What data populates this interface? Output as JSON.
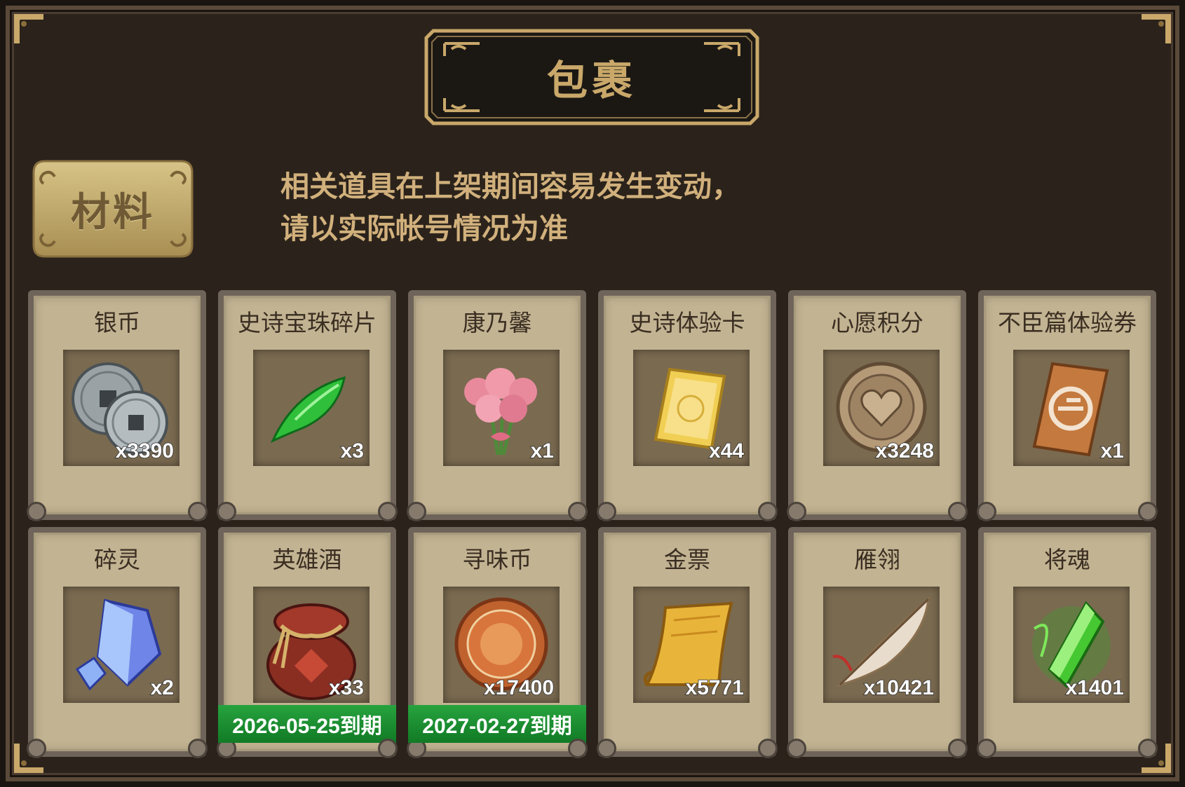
{
  "window": {
    "title": "包裹"
  },
  "tab": {
    "label": "材料"
  },
  "notice": {
    "line1": "相关道具在上架期间容易发生变动，",
    "line2": "请以实际帐号情况为准"
  },
  "items": [
    {
      "name": "银币",
      "quantity": "x3390",
      "icon": "silver-coins-icon"
    },
    {
      "name": "史诗宝珠碎片",
      "quantity": "x3",
      "icon": "green-gem-shard-icon"
    },
    {
      "name": "康乃馨",
      "quantity": "x1",
      "icon": "carnation-bouquet-icon"
    },
    {
      "name": "史诗体验卡",
      "quantity": "x44",
      "icon": "gold-card-icon"
    },
    {
      "name": "心愿积分",
      "quantity": "x3248",
      "icon": "heart-coin-icon"
    },
    {
      "name": "不臣篇体验券",
      "quantity": "x1",
      "icon": "ticket-icon"
    },
    {
      "name": "碎灵",
      "quantity": "x2",
      "icon": "blue-crystal-icon"
    },
    {
      "name": "英雄酒",
      "quantity": "x33",
      "icon": "wine-jar-icon",
      "expiry": "2026-05-25到期"
    },
    {
      "name": "寻味币",
      "quantity": "x17400",
      "icon": "taste-coin-icon",
      "expiry": "2027-02-27到期"
    },
    {
      "name": "金票",
      "quantity": "x5771",
      "icon": "gold-scroll-icon"
    },
    {
      "name": "雁翎",
      "quantity": "x10421",
      "icon": "feather-icon"
    },
    {
      "name": "将魂",
      "quantity": "x1401",
      "icon": "green-soul-crystal-icon"
    }
  ]
}
